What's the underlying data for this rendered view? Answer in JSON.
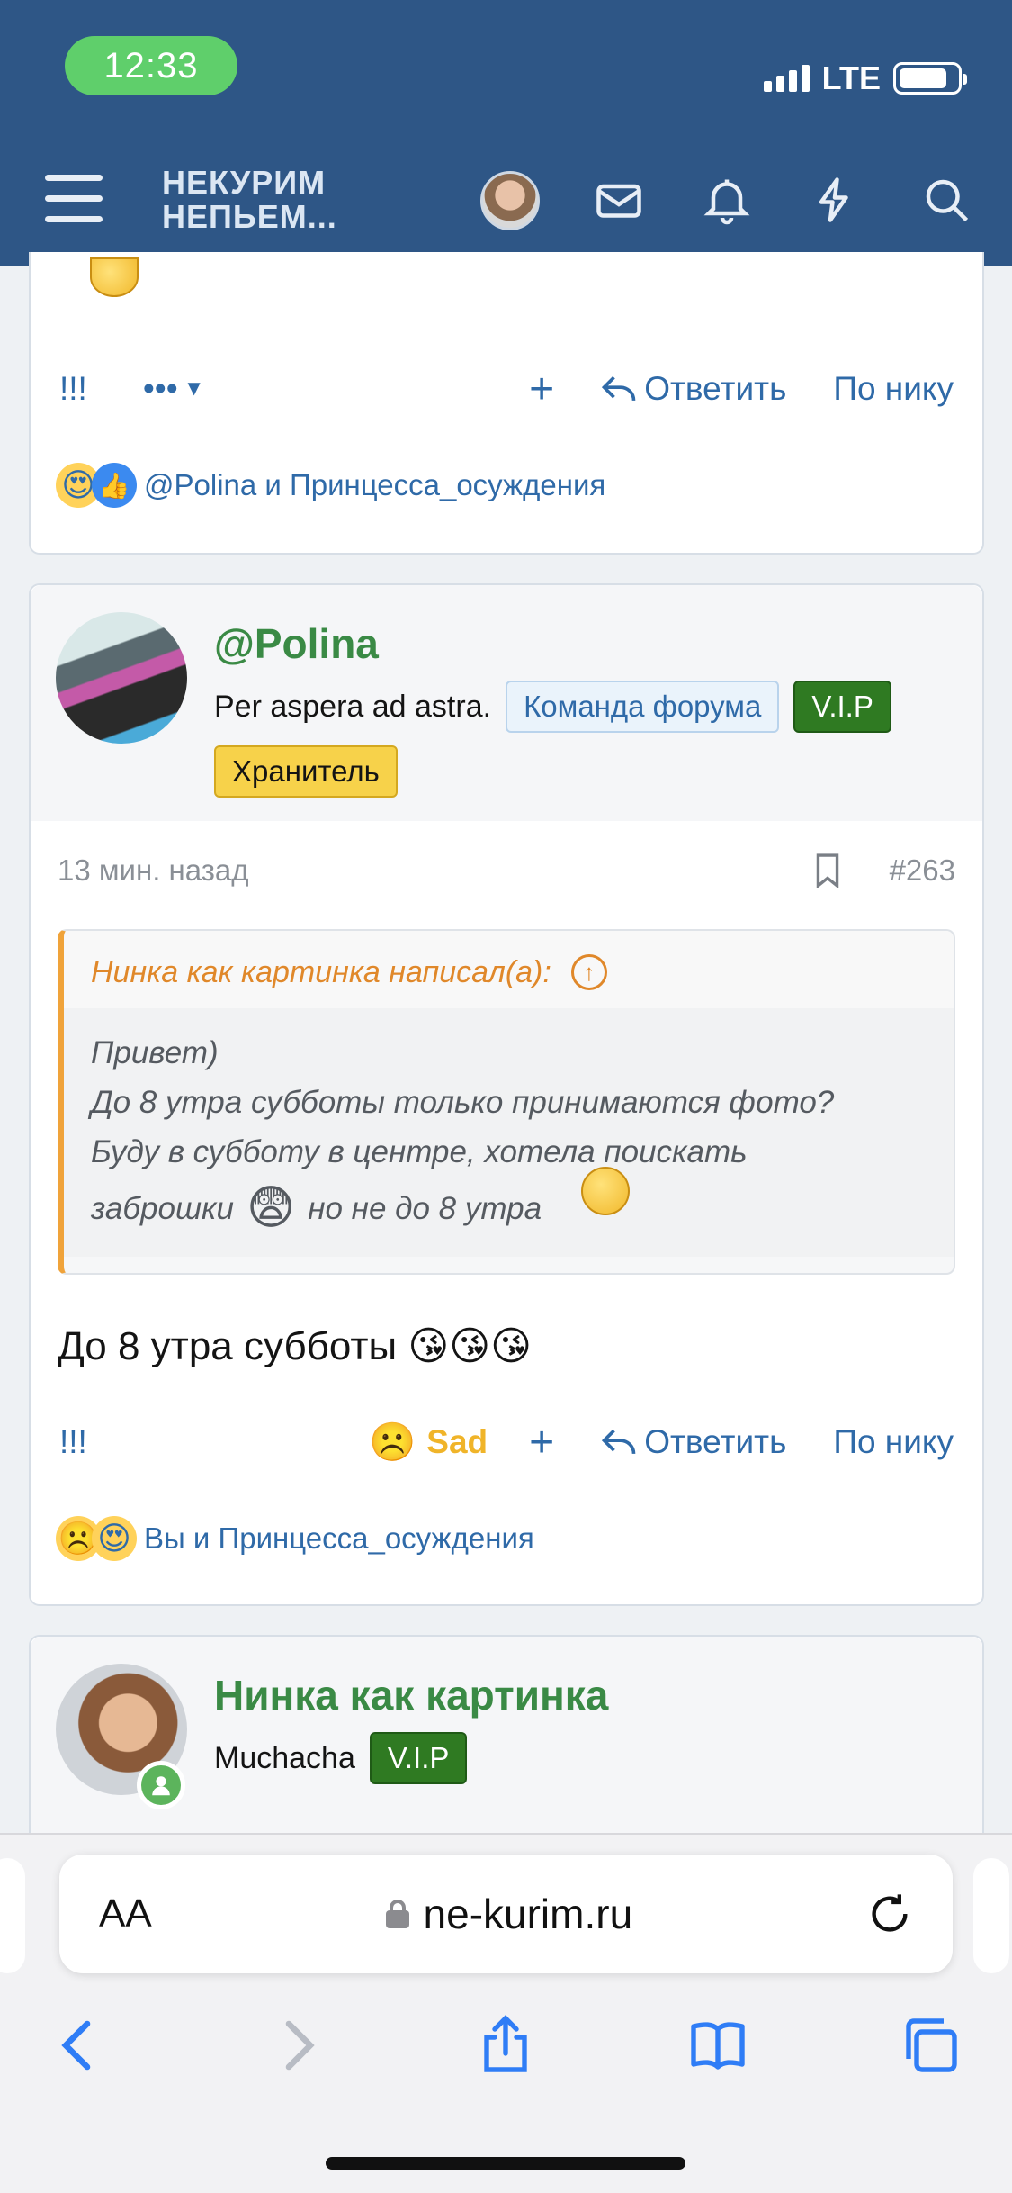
{
  "status": {
    "time": "12:33",
    "network": "LTE"
  },
  "header": {
    "logo_line1": "НЕКУРИМ",
    "logo_line2": "НЕПЬЕМ..."
  },
  "post1": {
    "actions": {
      "mark": "!!!",
      "more": "•••",
      "plus": "+",
      "reply": "Ответить",
      "by_nick": "По нику"
    },
    "reactions_text": "@Polina и Принцесса_осуждения"
  },
  "post2": {
    "author": "@Polina",
    "author_title": "Per aspera ad astra.",
    "badges": {
      "team": "Команда форума",
      "vip": "V.I.P",
      "keeper": "Хранитель"
    },
    "time": "13 мин. назад",
    "post_number": "#263",
    "quote": {
      "header": "Нинка как картинка написал(а):",
      "line1": "Привет)",
      "line2": "До 8 утра субботы только принимаются фото?",
      "line3": "Буду в субботу в центре, хотела поискать",
      "line4a": "заброшки",
      "line4b": "но не до 8 утра"
    },
    "text": "До 8 утра субботы",
    "kiss_emojis": "😘😘😘",
    "actions": {
      "mark": "!!!",
      "sad": "Sad",
      "plus": "+",
      "reply": "Ответить",
      "by_nick": "По нику"
    },
    "reactions_text": "Вы и Принцесса_осуждения"
  },
  "post3": {
    "author": "Нинка как картинка",
    "author_title": "Muchacha",
    "badges": {
      "vip": "V.I.P"
    }
  },
  "browser": {
    "aa": "AA",
    "url": "ne-kurim.ru"
  },
  "colors": {
    "header_bg": "#2e5686",
    "link": "#2f6aa8",
    "author_green": "#3a8a45",
    "vip_green": "#2f7a22",
    "keeper_yellow": "#f7d24a",
    "quote_orange": "#e0882a"
  }
}
